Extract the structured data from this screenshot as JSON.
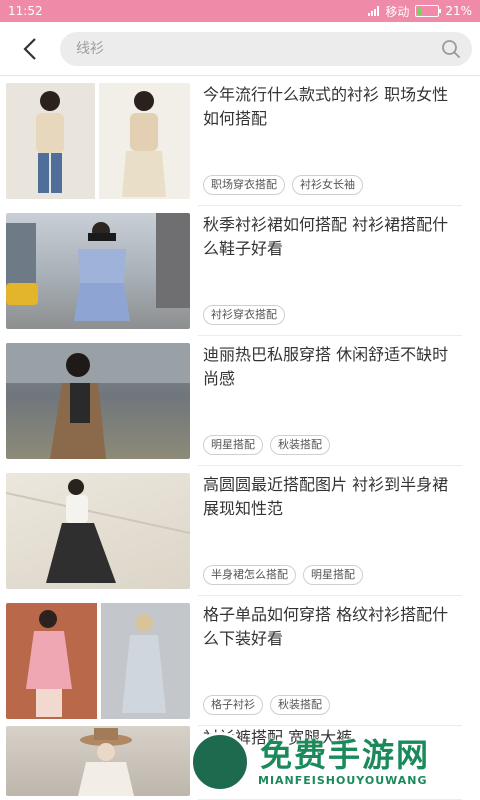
{
  "status": {
    "time": "11:52",
    "carrier": "移动",
    "battery": "21%",
    "battery_level": 0.21
  },
  "search": {
    "placeholder": "线衫"
  },
  "articles": [
    {
      "title": "今年流行什么款式的衬衫 职场女性如何搭配",
      "tags": [
        "职场穿衣搭配",
        "衬衫女长袖"
      ]
    },
    {
      "title": "秋季衬衫裙如何搭配 衬衫裙搭配什么鞋子好看",
      "tags": [
        "衬衫穿衣搭配"
      ]
    },
    {
      "title": "迪丽热巴私服穿搭 休闲舒适不缺时尚感",
      "tags": [
        "明星搭配",
        "秋装搭配"
      ]
    },
    {
      "title": "高圆圆最近搭配图片 衬衫到半身裙展现知性范",
      "tags": [
        "半身裙怎么搭配",
        "明星搭配"
      ]
    },
    {
      "title": "格子单品如何穿搭 格纹衬衫搭配什么下装好看",
      "tags": [
        "格子衬衫",
        "秋装搭配"
      ]
    },
    {
      "title": "衬衫裤搭配 宽腿大裤",
      "tags": []
    }
  ],
  "watermark": {
    "text": "免费手游网",
    "sub": "MIANFEISHOUYOUWANG"
  }
}
